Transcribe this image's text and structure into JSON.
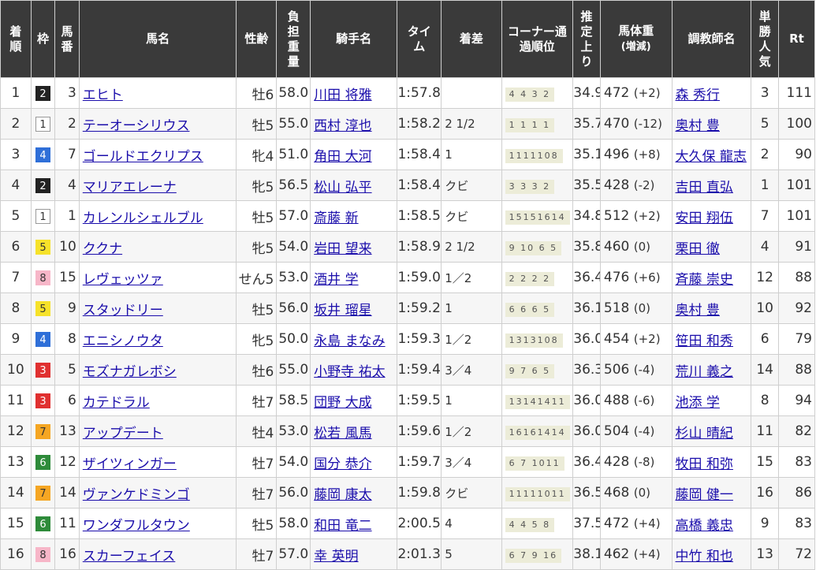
{
  "headers": {
    "rank": "着順",
    "waku": "枠",
    "umaban": "馬番",
    "horse": "馬名",
    "sexage": "性齢",
    "weight": "負担重量",
    "jockey": "騎手名",
    "time": "タイム",
    "margin": "着差",
    "corner": "コーナー通過順位",
    "last3f": "推定上り",
    "body": "馬体重",
    "body_sub": "(増減)",
    "trainer": "調教師名",
    "pop": "単勝人気",
    "rt": "Rt"
  },
  "waku_colors": {
    "1": {
      "bg": "#ffffff",
      "fg": "#333333",
      "border": "#999999"
    },
    "2": {
      "bg": "#222222",
      "fg": "#ffffff",
      "border": "#222222"
    },
    "3": {
      "bg": "#e03030",
      "fg": "#ffffff",
      "border": "#e03030"
    },
    "4": {
      "bg": "#2f6fd8",
      "fg": "#ffffff",
      "border": "#2f6fd8"
    },
    "5": {
      "bg": "#f6e22a",
      "fg": "#333333",
      "border": "#f6e22a"
    },
    "6": {
      "bg": "#2e8b3a",
      "fg": "#ffffff",
      "border": "#2e8b3a"
    },
    "7": {
      "bg": "#f5a623",
      "fg": "#333333",
      "border": "#f5a623"
    },
    "8": {
      "bg": "#f7b6c8",
      "fg": "#333333",
      "border": "#f7b6c8"
    }
  },
  "rows": [
    {
      "rank": "1",
      "waku": "2",
      "umaban": "3",
      "horse": "エヒト",
      "sexage": "牡6",
      "weight": "58.0",
      "jockey": "川田 将雅",
      "time": "1:57.8",
      "margin": "",
      "corner": "4 4 3 2",
      "last3f": "34.9",
      "body": "472",
      "chg": "(+2)",
      "trainer": "森 秀行",
      "pop": "3",
      "rt": "111"
    },
    {
      "rank": "2",
      "waku": "1",
      "umaban": "2",
      "horse": "テーオーシリウス",
      "sexage": "牡5",
      "weight": "55.0",
      "jockey": "西村 淳也",
      "time": "1:58.2",
      "margin": "2 1/2",
      "corner": "1 1 1 1",
      "last3f": "35.7",
      "body": "470",
      "chg": "(-12)",
      "trainer": "奥村 豊",
      "pop": "5",
      "rt": "100"
    },
    {
      "rank": "3",
      "waku": "4",
      "umaban": "7",
      "horse": "ゴールドエクリプス",
      "sexage": "牝4",
      "weight": "51.0",
      "jockey": "角田 大河",
      "time": "1:58.4",
      "margin": "1",
      "corner": "1111108",
      "last3f": "35.1",
      "body": "496",
      "chg": "(+8)",
      "trainer": "大久保 龍志",
      "pop": "2",
      "rt": "90"
    },
    {
      "rank": "4",
      "waku": "2",
      "umaban": "4",
      "horse": "マリアエレーナ",
      "sexage": "牝5",
      "weight": "56.5",
      "jockey": "松山 弘平",
      "time": "1:58.4",
      "margin": "クビ",
      "corner": "3 3 3 2",
      "last3f": "35.5",
      "body": "428",
      "chg": "(-2)",
      "trainer": "吉田 直弘",
      "pop": "1",
      "rt": "101"
    },
    {
      "rank": "5",
      "waku": "1",
      "umaban": "1",
      "horse": "カレンルシェルブル",
      "sexage": "牡5",
      "weight": "57.0",
      "jockey": "斎藤 新",
      "time": "1:58.5",
      "margin": "クビ",
      "corner": "15151614",
      "last3f": "34.8",
      "body": "512",
      "chg": "(+2)",
      "trainer": "安田 翔伍",
      "pop": "7",
      "rt": "101"
    },
    {
      "rank": "6",
      "waku": "5",
      "umaban": "10",
      "horse": "ククナ",
      "sexage": "牝5",
      "weight": "54.0",
      "jockey": "岩田 望来",
      "time": "1:58.9",
      "margin": "2 1/2",
      "corner": "9 10 6 5",
      "last3f": "35.8",
      "body": "460",
      "chg": "(0)",
      "trainer": "栗田 徹",
      "pop": "4",
      "rt": "91"
    },
    {
      "rank": "7",
      "waku": "8",
      "umaban": "15",
      "horse": "レヴェッツァ",
      "sexage": "せん5",
      "weight": "53.0",
      "jockey": "酒井 学",
      "time": "1:59.0",
      "margin": "1／2",
      "corner": "2 2 2 2",
      "last3f": "36.4",
      "body": "476",
      "chg": "(+6)",
      "trainer": "斉藤 崇史",
      "pop": "12",
      "rt": "88"
    },
    {
      "rank": "8",
      "waku": "5",
      "umaban": "9",
      "horse": "スタッドリー",
      "sexage": "牡5",
      "weight": "56.0",
      "jockey": "坂井 瑠星",
      "time": "1:59.2",
      "margin": "1",
      "corner": "6 6 6 5",
      "last3f": "36.1",
      "body": "518",
      "chg": "(0)",
      "trainer": "奥村 豊",
      "pop": "10",
      "rt": "92"
    },
    {
      "rank": "9",
      "waku": "4",
      "umaban": "8",
      "horse": "エニシノウタ",
      "sexage": "牝5",
      "weight": "50.0",
      "jockey": "永島 まなみ",
      "time": "1:59.3",
      "margin": "1／2",
      "corner": "1313108",
      "last3f": "36.0",
      "body": "454",
      "chg": "(+2)",
      "trainer": "笹田 和秀",
      "pop": "6",
      "rt": "79"
    },
    {
      "rank": "10",
      "waku": "3",
      "umaban": "5",
      "horse": "モズナガレボシ",
      "sexage": "牡6",
      "weight": "55.0",
      "jockey": "小野寺 祐太",
      "time": "1:59.4",
      "margin": "3／4",
      "corner": "9 7 6 5",
      "last3f": "36.3",
      "body": "506",
      "chg": "(-4)",
      "trainer": "荒川 義之",
      "pop": "14",
      "rt": "88"
    },
    {
      "rank": "11",
      "waku": "3",
      "umaban": "6",
      "horse": "カテドラル",
      "sexage": "牡7",
      "weight": "58.5",
      "jockey": "団野 大成",
      "time": "1:59.5",
      "margin": "1",
      "corner": "13141411",
      "last3f": "36.0",
      "body": "488",
      "chg": "(-6)",
      "trainer": "池添 学",
      "pop": "8",
      "rt": "94"
    },
    {
      "rank": "12",
      "waku": "7",
      "umaban": "13",
      "horse": "アップデート",
      "sexage": "牡4",
      "weight": "53.0",
      "jockey": "松若 風馬",
      "time": "1:59.6",
      "margin": "1／2",
      "corner": "16161414",
      "last3f": "36.0",
      "body": "504",
      "chg": "(-4)",
      "trainer": "杉山 晴紀",
      "pop": "11",
      "rt": "82"
    },
    {
      "rank": "13",
      "waku": "6",
      "umaban": "12",
      "horse": "ザイツィンガー",
      "sexage": "牡7",
      "weight": "54.0",
      "jockey": "国分 恭介",
      "time": "1:59.7",
      "margin": "3／4",
      "corner": "6 7 1011",
      "last3f": "36.4",
      "body": "428",
      "chg": "(-8)",
      "trainer": "牧田 和弥",
      "pop": "15",
      "rt": "83"
    },
    {
      "rank": "14",
      "waku": "7",
      "umaban": "14",
      "horse": "ヴァンケドミンゴ",
      "sexage": "牡7",
      "weight": "56.0",
      "jockey": "藤岡 康太",
      "time": "1:59.8",
      "margin": "クビ",
      "corner": "11111011",
      "last3f": "36.5",
      "body": "468",
      "chg": "(0)",
      "trainer": "藤岡 健一",
      "pop": "16",
      "rt": "86"
    },
    {
      "rank": "15",
      "waku": "6",
      "umaban": "11",
      "horse": "ワンダフルタウン",
      "sexage": "牡5",
      "weight": "58.0",
      "jockey": "和田 竜二",
      "time": "2:00.5",
      "margin": "4",
      "corner": "4 4 5 8",
      "last3f": "37.5",
      "body": "472",
      "chg": "(+4)",
      "trainer": "高橋 義忠",
      "pop": "9",
      "rt": "83"
    },
    {
      "rank": "16",
      "waku": "8",
      "umaban": "16",
      "horse": "スカーフェイス",
      "sexage": "牡7",
      "weight": "57.0",
      "jockey": "幸 英明",
      "time": "2:01.3",
      "margin": "5",
      "corner": "6 7 9 16",
      "last3f": "38.1",
      "body": "462",
      "chg": "(+4)",
      "trainer": "中竹 和也",
      "pop": "13",
      "rt": "72"
    }
  ]
}
